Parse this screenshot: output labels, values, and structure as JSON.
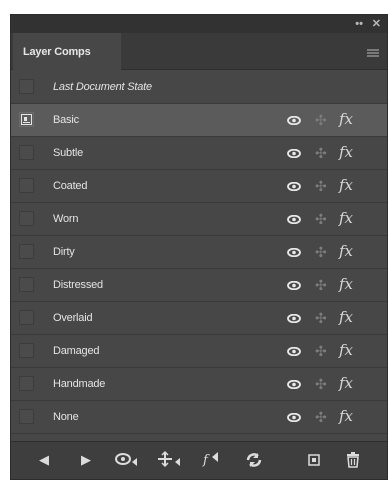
{
  "panel": {
    "tab_label": "Layer Comps",
    "window_controls": {
      "collapse": "••",
      "close": "✕"
    }
  },
  "comps": [
    {
      "label": "Last Document State",
      "selected": false,
      "last_state": true
    },
    {
      "label": "Basic",
      "selected": true,
      "last_state": false
    },
    {
      "label": "Subtle",
      "selected": false,
      "last_state": false
    },
    {
      "label": "Coated",
      "selected": false,
      "last_state": false
    },
    {
      "label": "Worn",
      "selected": false,
      "last_state": false
    },
    {
      "label": "Dirty",
      "selected": false,
      "last_state": false
    },
    {
      "label": "Distressed",
      "selected": false,
      "last_state": false
    },
    {
      "label": "Overlaid",
      "selected": false,
      "last_state": false
    },
    {
      "label": "Damaged",
      "selected": false,
      "last_state": false
    },
    {
      "label": "Handmade",
      "selected": false,
      "last_state": false
    },
    {
      "label": "None",
      "selected": false,
      "last_state": false
    }
  ],
  "footer": {
    "buttons": [
      "previous-comp-icon",
      "next-comp-icon",
      "apply-visibility-icon",
      "apply-position-icon",
      "apply-style-icon",
      "update-comp-icon",
      "new-comp-icon",
      "delete-comp-icon"
    ]
  },
  "colors": {
    "panel_bg": "#474747",
    "selected_row": "#5b5b5b",
    "text": "#e4e4e4"
  }
}
